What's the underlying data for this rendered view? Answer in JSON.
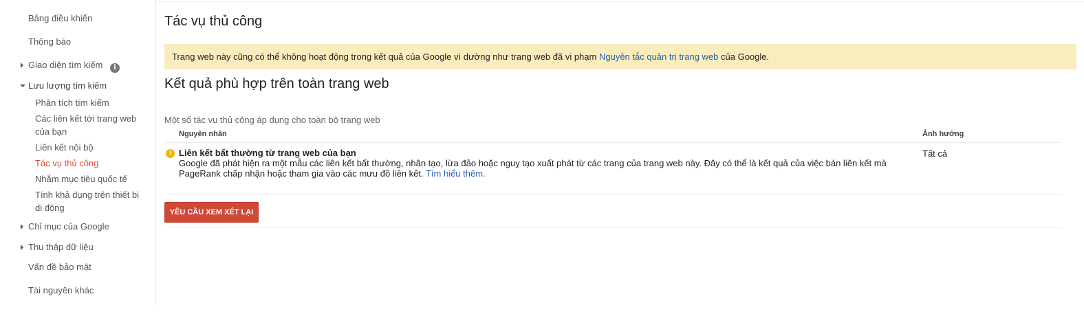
{
  "sidebar": {
    "dashboard": "Bảng điều khiển",
    "messages": "Thông báo",
    "search_appearance": "Giao diện tìm kiếm",
    "search_traffic": "Lưu lượng tìm kiếm",
    "sub_items": {
      "search_analytics": "Phân tích tìm kiếm",
      "links_to_site": "Các liên kết tới trang web của bạn",
      "internal_links": "Liên kết nội bộ",
      "manual_actions": "Tác vụ thủ công",
      "international_targeting": "Nhắm mục tiêu quốc tế",
      "mobile_usability": "Tính khả dụng trên thiết bị di động"
    },
    "google_index": "Chỉ mục của Google",
    "crawl": "Thu thập dữ liệu",
    "security_issues": "Vấn đề bảo mật",
    "other_resources": "Tài nguyên khác"
  },
  "main": {
    "title": "Tác vụ thủ công",
    "warning": {
      "text_before": "Trang web này cũng có thể không hoạt động trong kết quả của Google vì dường như trang web đã vi phạm ",
      "link": "Nguyên tắc quản trị trang web",
      "text_after": " của Google."
    },
    "section_title": "Kết quả phù hợp trên toàn trang web",
    "section_desc": "Một số tác vụ thủ công áp dụng cho toàn bộ trang web",
    "table": {
      "col_reason": "Nguyên nhân",
      "col_impact": "Ảnh hưởng",
      "row": {
        "title": "Liên kết bất thường từ trang web của bạn",
        "desc": "Google đã phát hiện ra một mẫu các liên kết bất thường, nhân tạo, lừa đảo hoặc nguỵ tạo xuất phát từ các trang của trang web này. Đây có thể là kết quả của việc bán liên kết mà PageRank chấp nhận hoặc tham gia vào các mưu đồ liên kết. ",
        "learn_more": "Tìm hiểu thêm.",
        "impact": "Tất cả"
      }
    },
    "button_label": "YÊU CẦU XEM XÉT LẠI"
  },
  "colors": {
    "active_nav": "#dd4b39",
    "warning_bg": "#f9edbe",
    "link": "#2a5db0",
    "button_bg": "#d14836",
    "warn_icon": "#f4b400"
  },
  "icons": [
    "info-icon",
    "warning-icon",
    "expand-arrow-icon",
    "collapse-arrow-icon"
  ]
}
